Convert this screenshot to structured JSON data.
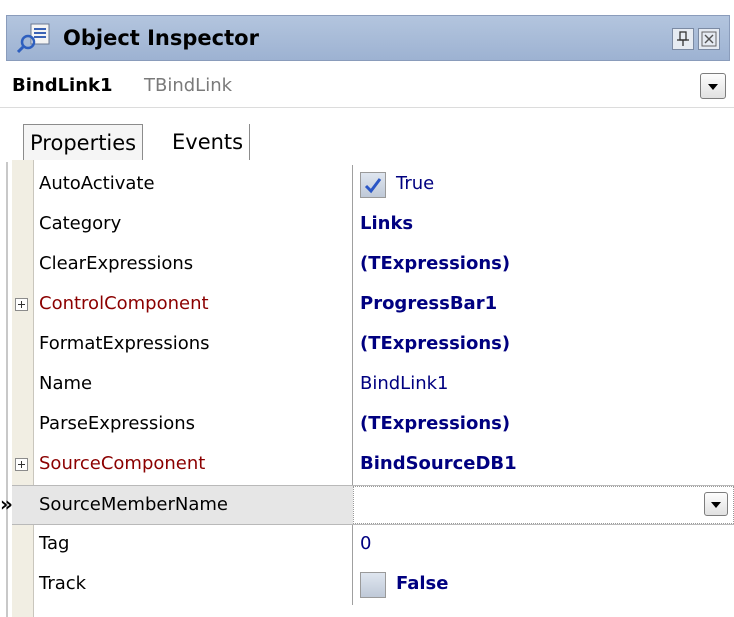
{
  "window": {
    "title": "Object Inspector"
  },
  "component": {
    "name": "BindLink1",
    "type": "TBindLink"
  },
  "tabs": [
    {
      "label": "Properties",
      "active": true
    },
    {
      "label": "Events",
      "active": false
    }
  ],
  "properties": [
    {
      "name": "AutoActivate",
      "value": "True",
      "checkbox": true,
      "checked": true
    },
    {
      "name": "Category",
      "value": "Links",
      "bold": true
    },
    {
      "name": "ClearExpressions",
      "value": "(TExpressions)",
      "bold": true
    },
    {
      "name": "ControlComponent",
      "value": "ProgressBar1",
      "bold": true,
      "expandable": true,
      "reference": true
    },
    {
      "name": "FormatExpressions",
      "value": "(TExpressions)",
      "bold": true
    },
    {
      "name": "Name",
      "value": "BindLink1"
    },
    {
      "name": "ParseExpressions",
      "value": "(TExpressions)",
      "bold": true
    },
    {
      "name": "SourceComponent",
      "value": "BindSourceDB1",
      "bold": true,
      "expandable": true,
      "reference": true
    },
    {
      "name": "SourceMemberName",
      "value": "",
      "selected": true,
      "dropdown": true
    },
    {
      "name": "Tag",
      "value": "0"
    },
    {
      "name": "Track",
      "value": "False",
      "bold": true,
      "checkbox": true,
      "checked": false
    }
  ],
  "selected_row_marker": "»",
  "colors": {
    "titlebar": "#a9bcd8",
    "value_text": "#000080",
    "reference_name": "#8b0000"
  }
}
